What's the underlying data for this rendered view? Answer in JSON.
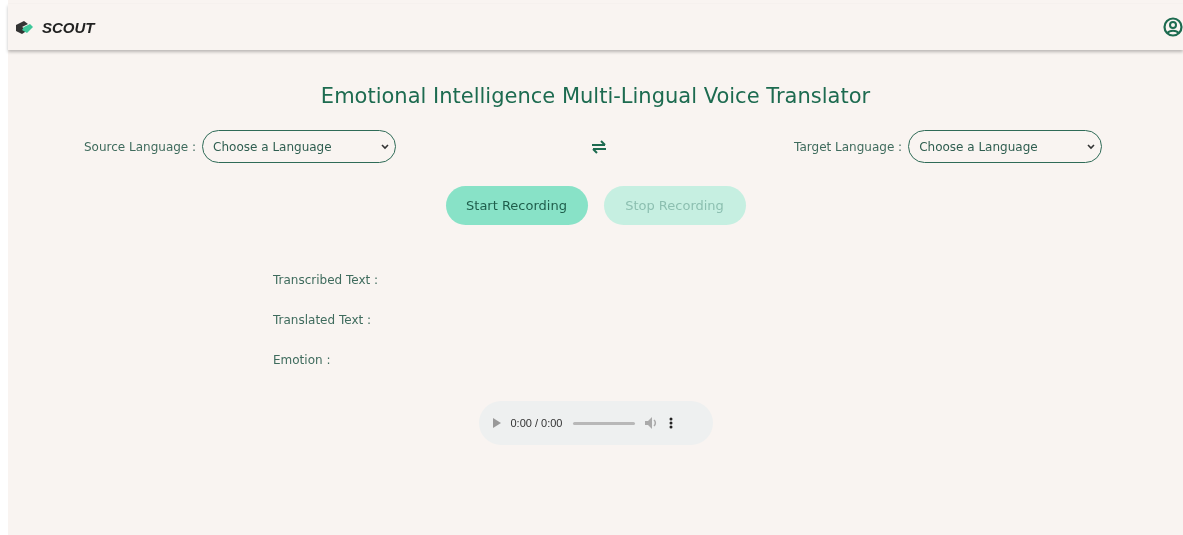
{
  "navbar": {
    "brand": "SCOUT"
  },
  "title": "Emotional Intelligence Multi-Lingual Voice Translator",
  "source": {
    "label": "Source Language :",
    "value": "Choose a Language"
  },
  "target": {
    "label": "Target Language :",
    "value": "Choose a Language"
  },
  "buttons": [
    {
      "label": "Start Recording",
      "disabled": false
    },
    {
      "label": "Stop Recording",
      "disabled": true
    }
  ],
  "results": [
    {
      "label": "Transcribed Text :"
    },
    {
      "label": "Translated Text :"
    },
    {
      "label": "Emotion :"
    }
  ],
  "audio": {
    "time": "0:00 / 0:00",
    "level": 0
  }
}
